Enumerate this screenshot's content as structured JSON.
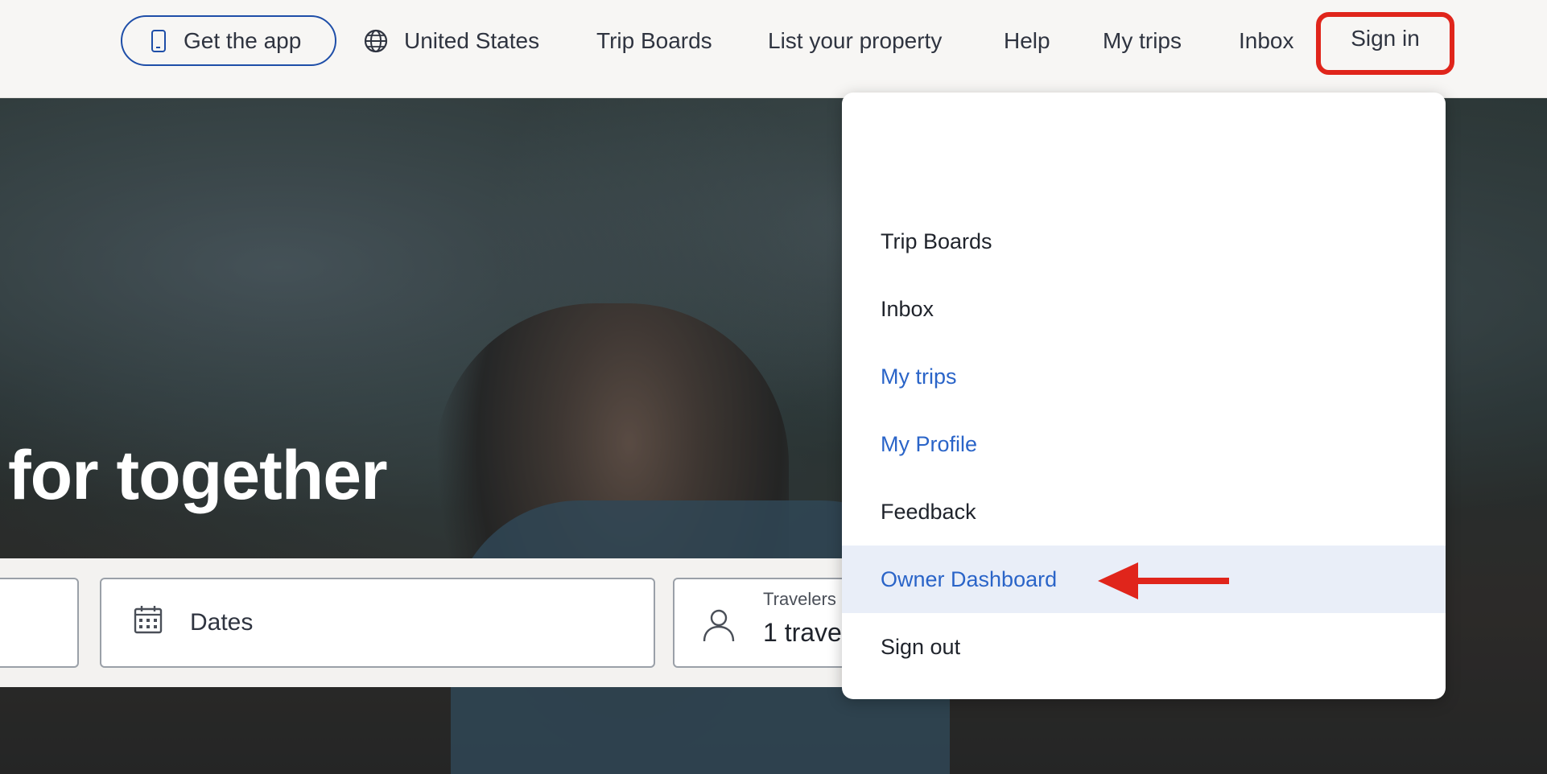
{
  "header": {
    "get_app_label": "Get the app",
    "region_label": "United States",
    "nav": {
      "trip_boards": "Trip Boards",
      "list_property": "List your property",
      "help": "Help",
      "my_trips": "My trips",
      "inbox": "Inbox",
      "sign_in": "Sign in"
    }
  },
  "hero": {
    "title": "for together"
  },
  "search": {
    "dates_label": "Dates",
    "travelers_label": "Travelers",
    "travelers_value": "1 traveler"
  },
  "dropdown": {
    "items": [
      {
        "label": "Trip Boards",
        "link": false,
        "active": false
      },
      {
        "label": "Inbox",
        "link": false,
        "active": false
      },
      {
        "label": "My trips",
        "link": true,
        "active": false
      },
      {
        "label": "My Profile",
        "link": true,
        "active": false
      },
      {
        "label": "Feedback",
        "link": false,
        "active": false
      },
      {
        "label": "Owner Dashboard",
        "link": true,
        "active": true
      },
      {
        "label": "Sign out",
        "link": false,
        "active": false
      }
    ]
  },
  "colors": {
    "accent_link": "#2a64c8",
    "highlight_red": "#e0251b",
    "active_row": "#e9eef8"
  },
  "icons": [
    "phone-icon",
    "globe-icon",
    "calendar-icon",
    "person-icon",
    "arrow-icon"
  ]
}
